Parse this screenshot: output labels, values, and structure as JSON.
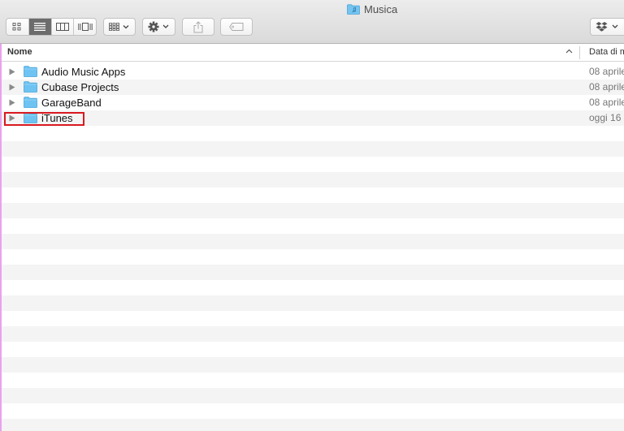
{
  "window": {
    "title": "Musica",
    "title_icon": "music-folder-icon"
  },
  "toolbar": {
    "view_modes": [
      {
        "name": "icon-view",
        "icon": "grid-icon",
        "active": false
      },
      {
        "name": "list-view",
        "icon": "list-icon",
        "active": true
      },
      {
        "name": "column-view",
        "icon": "columns-icon",
        "active": false
      },
      {
        "name": "coverflow-view",
        "icon": "coverflow-icon",
        "active": false
      }
    ],
    "arrange_icon": "arrange-grid-icon",
    "action_icon": "gear-icon",
    "share_icon": "share-icon",
    "tag_icon": "tag-icon",
    "dropbox_icon": "dropbox-icon"
  },
  "list": {
    "columns": {
      "name": "Nome",
      "date": "Data di m"
    },
    "sort": "ascending",
    "items": [
      {
        "name": "Audio Music Apps",
        "date": "08 aprile"
      },
      {
        "name": "Cubase Projects",
        "date": "08 aprile"
      },
      {
        "name": "GarageBand",
        "date": "08 aprile"
      },
      {
        "name": "iTunes",
        "date": "oggi 16"
      }
    ],
    "highlighted_item": "iTunes"
  },
  "colors": {
    "folder": "#6ec3f2",
    "selection_highlight": "#d9191f",
    "stripe": "#f4f4f4",
    "toolbar": "#e2e2e2"
  }
}
